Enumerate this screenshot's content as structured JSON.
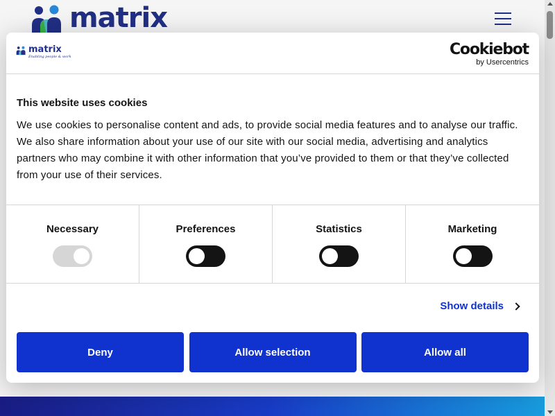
{
  "site": {
    "logo_text": "matrix",
    "brand_color": "#23318a"
  },
  "dialog": {
    "logo_text": "matrix",
    "logo_tagline": "Enabling people & work",
    "provider_name": "Cookiebot",
    "provider_sub": "by Usercentrics",
    "title": "This website uses cookies",
    "body": "We use cookies to personalise content and ads, to provide social media features and to analyse our traffic. We also share information about your use of our site with our social media, advertising and analytics partners who may combine it with other information that you’ve provided to them or that they’ve collected from your use of their services.",
    "toggles": [
      {
        "label": "Necessary",
        "checked": true,
        "disabled": true
      },
      {
        "label": "Preferences",
        "checked": false,
        "disabled": false
      },
      {
        "label": "Statistics",
        "checked": false,
        "disabled": false
      },
      {
        "label": "Marketing",
        "checked": false,
        "disabled": false
      }
    ],
    "show_details": "Show details",
    "buttons": {
      "deny": "Deny",
      "allow_selection": "Allow selection",
      "allow_all": "Allow all"
    },
    "accent_color": "#1032cf"
  }
}
